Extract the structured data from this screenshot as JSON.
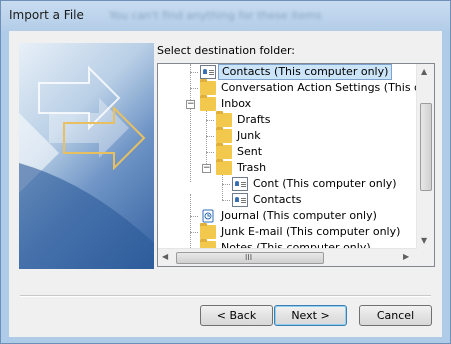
{
  "window": {
    "title": "Import a File",
    "blurred_title": "You can't find anything for these items"
  },
  "dialog": {
    "prompt": "Select destination folder:"
  },
  "tree": {
    "items": [
      {
        "label": "Contacts (This computer only)",
        "icon": "contact-card-icon",
        "selected": true
      },
      {
        "label": "Conversation Action Settings (This c",
        "icon": "folder-icon"
      },
      {
        "label": "Inbox",
        "icon": "inbox-folder-icon",
        "expander": "⊟"
      },
      {
        "label": "Drafts",
        "icon": "folder-icon"
      },
      {
        "label": "Junk",
        "icon": "folder-icon"
      },
      {
        "label": "Sent",
        "icon": "folder-icon"
      },
      {
        "label": "Trash",
        "icon": "folder-icon",
        "expander": "⊟"
      },
      {
        "label": "Cont (This computer only)",
        "icon": "contact-card-icon"
      },
      {
        "label": "Contacts",
        "icon": "contact-card-icon"
      },
      {
        "label": "Journal (This computer only)",
        "icon": "journal-icon"
      },
      {
        "label": "Junk E-mail (This computer only)",
        "icon": "folder-icon"
      },
      {
        "label": "Notes (This computer only)",
        "icon": "folder-icon"
      }
    ],
    "hscroll_grip": "III"
  },
  "buttons": {
    "back": "< Back",
    "next": "Next >",
    "cancel": "Cancel"
  },
  "colors": {
    "selection": "#cce4f7",
    "title_bar": "#b3cde8"
  }
}
